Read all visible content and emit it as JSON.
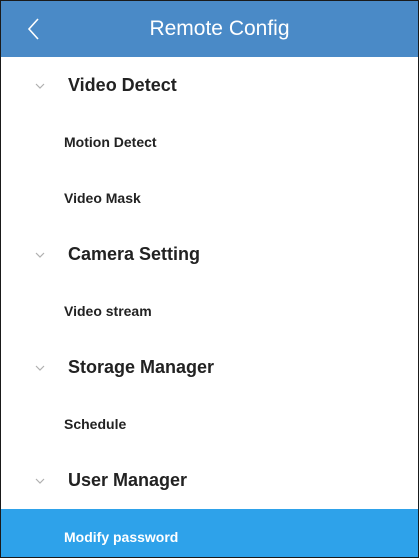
{
  "header": {
    "title": "Remote Config",
    "back_icon": "chevron-left-icon"
  },
  "colors": {
    "header_bg": "#4a8ac7",
    "selected_bg": "#2ea2ea"
  },
  "groups": [
    {
      "label": "Video Detect",
      "items": [
        "Motion Detect",
        "Video Mask"
      ]
    },
    {
      "label": "Camera Setting",
      "items": [
        "Video stream"
      ]
    },
    {
      "label": "Storage Manager",
      "items": [
        "Schedule"
      ]
    },
    {
      "label": "User Manager",
      "items": [
        "Modify password"
      ]
    }
  ],
  "selected_item": "Modify password"
}
